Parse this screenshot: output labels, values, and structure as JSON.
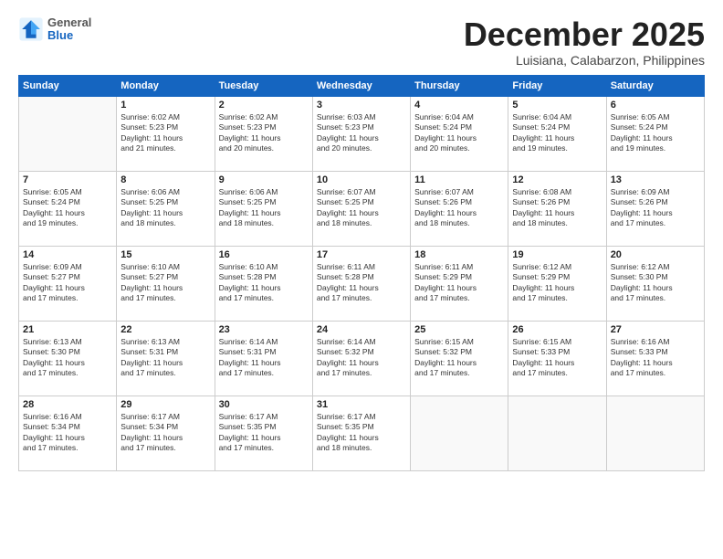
{
  "logo": {
    "general": "General",
    "blue": "Blue"
  },
  "header": {
    "month": "December 2025",
    "location": "Luisiana, Calabarzon, Philippines"
  },
  "weekdays": [
    "Sunday",
    "Monday",
    "Tuesday",
    "Wednesday",
    "Thursday",
    "Friday",
    "Saturday"
  ],
  "weeks": [
    [
      {
        "day": "",
        "info": ""
      },
      {
        "day": "1",
        "info": "Sunrise: 6:02 AM\nSunset: 5:23 PM\nDaylight: 11 hours\nand 21 minutes."
      },
      {
        "day": "2",
        "info": "Sunrise: 6:02 AM\nSunset: 5:23 PM\nDaylight: 11 hours\nand 20 minutes."
      },
      {
        "day": "3",
        "info": "Sunrise: 6:03 AM\nSunset: 5:23 PM\nDaylight: 11 hours\nand 20 minutes."
      },
      {
        "day": "4",
        "info": "Sunrise: 6:04 AM\nSunset: 5:24 PM\nDaylight: 11 hours\nand 20 minutes."
      },
      {
        "day": "5",
        "info": "Sunrise: 6:04 AM\nSunset: 5:24 PM\nDaylight: 11 hours\nand 19 minutes."
      },
      {
        "day": "6",
        "info": "Sunrise: 6:05 AM\nSunset: 5:24 PM\nDaylight: 11 hours\nand 19 minutes."
      }
    ],
    [
      {
        "day": "7",
        "info": "Sunrise: 6:05 AM\nSunset: 5:24 PM\nDaylight: 11 hours\nand 19 minutes."
      },
      {
        "day": "8",
        "info": "Sunrise: 6:06 AM\nSunset: 5:25 PM\nDaylight: 11 hours\nand 18 minutes."
      },
      {
        "day": "9",
        "info": "Sunrise: 6:06 AM\nSunset: 5:25 PM\nDaylight: 11 hours\nand 18 minutes."
      },
      {
        "day": "10",
        "info": "Sunrise: 6:07 AM\nSunset: 5:25 PM\nDaylight: 11 hours\nand 18 minutes."
      },
      {
        "day": "11",
        "info": "Sunrise: 6:07 AM\nSunset: 5:26 PM\nDaylight: 11 hours\nand 18 minutes."
      },
      {
        "day": "12",
        "info": "Sunrise: 6:08 AM\nSunset: 5:26 PM\nDaylight: 11 hours\nand 18 minutes."
      },
      {
        "day": "13",
        "info": "Sunrise: 6:09 AM\nSunset: 5:26 PM\nDaylight: 11 hours\nand 17 minutes."
      }
    ],
    [
      {
        "day": "14",
        "info": "Sunrise: 6:09 AM\nSunset: 5:27 PM\nDaylight: 11 hours\nand 17 minutes."
      },
      {
        "day": "15",
        "info": "Sunrise: 6:10 AM\nSunset: 5:27 PM\nDaylight: 11 hours\nand 17 minutes."
      },
      {
        "day": "16",
        "info": "Sunrise: 6:10 AM\nSunset: 5:28 PM\nDaylight: 11 hours\nand 17 minutes."
      },
      {
        "day": "17",
        "info": "Sunrise: 6:11 AM\nSunset: 5:28 PM\nDaylight: 11 hours\nand 17 minutes."
      },
      {
        "day": "18",
        "info": "Sunrise: 6:11 AM\nSunset: 5:29 PM\nDaylight: 11 hours\nand 17 minutes."
      },
      {
        "day": "19",
        "info": "Sunrise: 6:12 AM\nSunset: 5:29 PM\nDaylight: 11 hours\nand 17 minutes."
      },
      {
        "day": "20",
        "info": "Sunrise: 6:12 AM\nSunset: 5:30 PM\nDaylight: 11 hours\nand 17 minutes."
      }
    ],
    [
      {
        "day": "21",
        "info": "Sunrise: 6:13 AM\nSunset: 5:30 PM\nDaylight: 11 hours\nand 17 minutes."
      },
      {
        "day": "22",
        "info": "Sunrise: 6:13 AM\nSunset: 5:31 PM\nDaylight: 11 hours\nand 17 minutes."
      },
      {
        "day": "23",
        "info": "Sunrise: 6:14 AM\nSunset: 5:31 PM\nDaylight: 11 hours\nand 17 minutes."
      },
      {
        "day": "24",
        "info": "Sunrise: 6:14 AM\nSunset: 5:32 PM\nDaylight: 11 hours\nand 17 minutes."
      },
      {
        "day": "25",
        "info": "Sunrise: 6:15 AM\nSunset: 5:32 PM\nDaylight: 11 hours\nand 17 minutes."
      },
      {
        "day": "26",
        "info": "Sunrise: 6:15 AM\nSunset: 5:33 PM\nDaylight: 11 hours\nand 17 minutes."
      },
      {
        "day": "27",
        "info": "Sunrise: 6:16 AM\nSunset: 5:33 PM\nDaylight: 11 hours\nand 17 minutes."
      }
    ],
    [
      {
        "day": "28",
        "info": "Sunrise: 6:16 AM\nSunset: 5:34 PM\nDaylight: 11 hours\nand 17 minutes."
      },
      {
        "day": "29",
        "info": "Sunrise: 6:17 AM\nSunset: 5:34 PM\nDaylight: 11 hours\nand 17 minutes."
      },
      {
        "day": "30",
        "info": "Sunrise: 6:17 AM\nSunset: 5:35 PM\nDaylight: 11 hours\nand 17 minutes."
      },
      {
        "day": "31",
        "info": "Sunrise: 6:17 AM\nSunset: 5:35 PM\nDaylight: 11 hours\nand 18 minutes."
      },
      {
        "day": "",
        "info": ""
      },
      {
        "day": "",
        "info": ""
      },
      {
        "day": "",
        "info": ""
      }
    ]
  ]
}
